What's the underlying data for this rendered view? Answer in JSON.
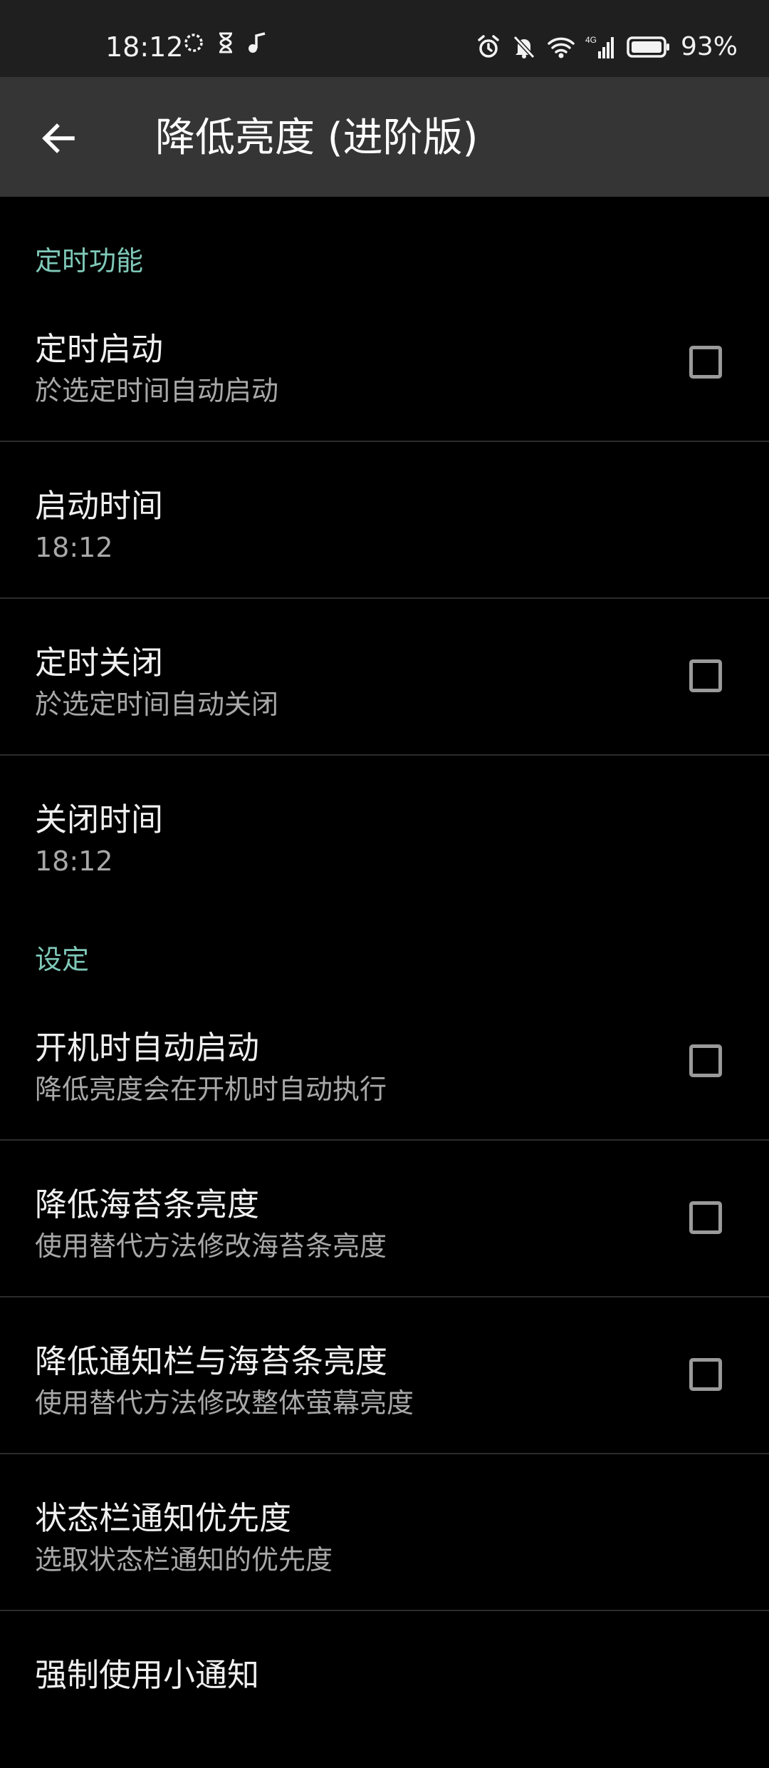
{
  "status_bar": {
    "time": "18:12",
    "battery_percent": "93%",
    "left_icons": [
      "sync-circle-icon",
      "hourglass-icon",
      "music-note-icon"
    ],
    "right_icons": [
      "alarm-icon",
      "bell-muted-icon",
      "wifi-icon",
      "signal-4g-icon",
      "battery-icon"
    ],
    "network_label": "4G"
  },
  "toolbar": {
    "title": "降低亮度 (进阶版)",
    "back_icon": "arrow-back-icon"
  },
  "sections": {
    "timer": {
      "header": "定时功能",
      "scheduled_start": {
        "title": "定时启动",
        "summary": "於选定时间自动启动",
        "checked": false
      },
      "start_time": {
        "title": "启动时间",
        "summary": "18:12"
      },
      "scheduled_stop": {
        "title": "定时关闭",
        "summary": "於选定时间自动关闭",
        "checked": false
      },
      "stop_time": {
        "title": "关闭时间",
        "summary": "18:12"
      }
    },
    "settings": {
      "header": "设定",
      "start_on_boot": {
        "title": "开机时自动启动",
        "summary": "降低亮度会在开机时自动执行",
        "checked": false
      },
      "dim_navbar": {
        "title": "降低海苔条亮度",
        "summary": "使用替代方法修改海苔条亮度",
        "checked": false
      },
      "dim_statusbar_navbar": {
        "title": "降低通知栏与海苔条亮度",
        "summary": "使用替代方法修改整体萤幕亮度",
        "checked": false
      },
      "notification_priority": {
        "title": "状态栏通知优先度",
        "summary": "选取状态栏通知的优先度"
      },
      "force_small_notification": {
        "title": "强制使用小通知"
      }
    }
  },
  "colors": {
    "background": "#000000",
    "toolbar": "#353535",
    "status_bar": "#1f1f1f",
    "section_header": "#7fc8b8",
    "summary_text": "#a8a8a8",
    "divider": "#2c2c2c"
  }
}
